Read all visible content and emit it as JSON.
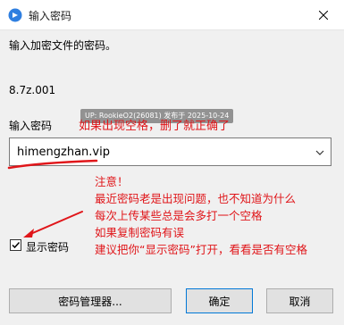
{
  "window": {
    "title": "输入密码",
    "app_icon": "tortoise-icon",
    "close_icon": "close-icon"
  },
  "prompt": "输入加密文件的密码。",
  "filename": "8.7z.001",
  "password_label": "输入密码",
  "password_value": "himengzhan.vip",
  "watermark": "UP: RookieO2(26081) 发布于 2025-10-24",
  "annotation_top": "如果出现空格，删了就正确了",
  "annotation_notes": [
    "注意！",
    "最近密码老是出现问题，也不知道为什么",
    "每次上传某些总是会多打一个空格",
    "如果复制密码有误",
    "建议把你“显示密码”打开，看看是否有空格"
  ],
  "show_password": {
    "label": "显示密码",
    "checked": true
  },
  "buttons": {
    "manager": "密码管理器...",
    "ok": "确定",
    "cancel": "取消"
  },
  "colors": {
    "annotation": "#e0161a",
    "accent": "#0078d7"
  }
}
